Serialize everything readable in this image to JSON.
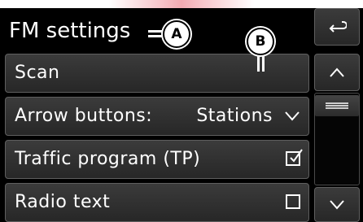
{
  "screen": {
    "title": "FM settings",
    "rows": [
      {
        "label": "Scan"
      },
      {
        "label": "Arrow buttons:",
        "value": "Stations"
      },
      {
        "label": "Traffic program (TP)",
        "checked": true
      },
      {
        "label": "Radio text",
        "checked": false
      }
    ],
    "scroll_position": 0.0
  },
  "side_buttons": {
    "back": "back-arrow-icon",
    "up": "chevron-up-icon",
    "thumb": "menu-lines-icon",
    "down": "chevron-down-icon"
  },
  "callouts": {
    "a": "A",
    "b": "B"
  },
  "colors": {
    "background": "#000000",
    "button_top": "#3b3b3b",
    "button_bottom": "#272727",
    "text": "#ffffff",
    "border": "#5f5f5f"
  }
}
